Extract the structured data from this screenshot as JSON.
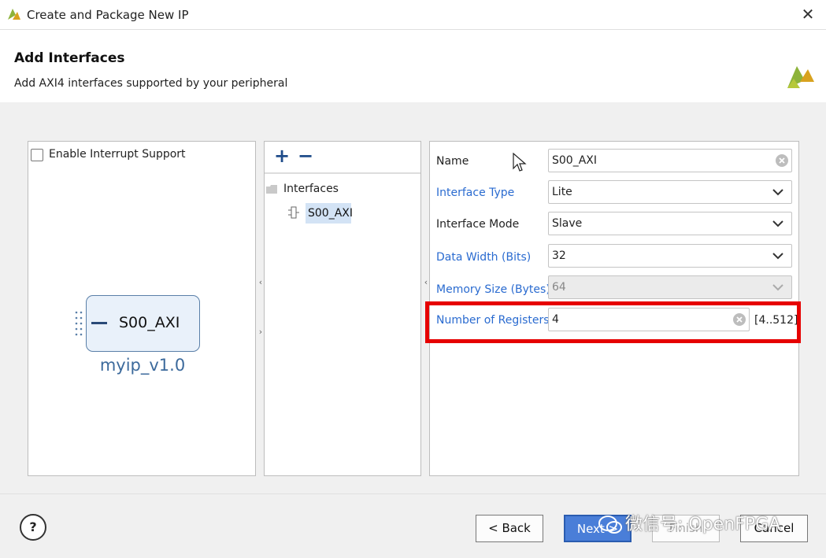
{
  "window": {
    "title": "Create and Package New IP"
  },
  "header": {
    "title": "Add Interfaces",
    "subtitle": "Add AXI4 interfaces supported by your peripheral"
  },
  "left_panel": {
    "interrupt_label": "Enable Interrupt Support",
    "interrupt_checked": false,
    "ip_port": "S00_AXI",
    "ip_name": "myip_v1.0"
  },
  "middle_panel": {
    "add_label": "+",
    "remove_label": "−",
    "tree_root": "Interfaces",
    "tree_items": [
      "S00_AXI"
    ]
  },
  "right_panel": {
    "fields": [
      {
        "label": "Name",
        "value": "S00_AXI",
        "control": "text"
      },
      {
        "label": "Interface Type",
        "value": "Lite",
        "control": "select"
      },
      {
        "label": "Interface Mode",
        "value": "Slave",
        "control": "select"
      },
      {
        "label": "Data Width (Bits)",
        "value": "32",
        "control": "select"
      },
      {
        "label": "Memory Size (Bytes)",
        "value": "64",
        "control": "select-disabled"
      },
      {
        "label": "Number of Registers",
        "value": "4",
        "control": "text",
        "range": "[4..512]"
      }
    ]
  },
  "footer": {
    "help": "?",
    "back": "< Back",
    "next": "Next >",
    "finish": "Finish",
    "cancel": "Cancel",
    "watermark": "微信号: OpenFPGA"
  },
  "colors": {
    "accent": "#4a7ed8",
    "label_blue": "#2a6bd0",
    "highlight_red": "#e60000",
    "selection": "#d3e3f5"
  }
}
